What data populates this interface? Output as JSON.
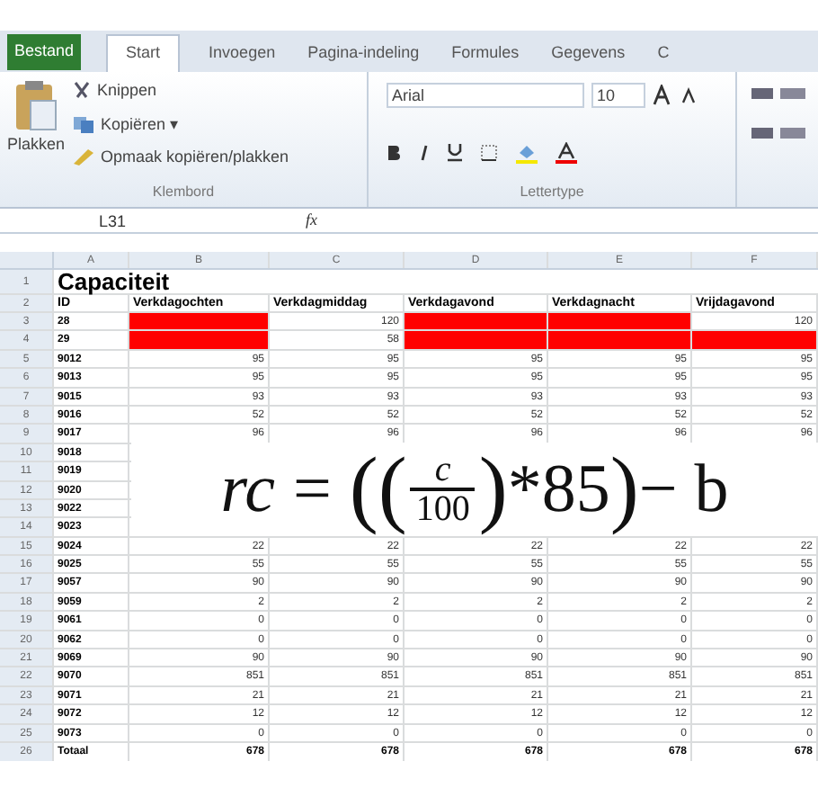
{
  "ribbon": {
    "file_tab": "Bestand",
    "tabs": [
      {
        "label": "Start",
        "selected": true
      },
      {
        "label": "Invoegen",
        "selected": false
      },
      {
        "label": "Pagina-indeling",
        "selected": false
      },
      {
        "label": "Formules",
        "selected": false
      },
      {
        "label": "Gegevens",
        "selected": false
      },
      {
        "label": "C",
        "selected": false
      }
    ],
    "clipboard": {
      "paste": "Plakken",
      "cut": "Knippen",
      "copy": "Kopiëren",
      "copy_caret": "▾",
      "format_painter": "Opmaak kopiëren/plakken",
      "group_label": "Klembord"
    },
    "font": {
      "family": "Arial",
      "size": "10",
      "group_label": "Lettertype"
    }
  },
  "formula_bar": {
    "name_box": "L31",
    "fx": "fx"
  },
  "columns": [
    "A",
    "B",
    "C",
    "D",
    "E",
    "F"
  ],
  "title_row": {
    "num": "1",
    "text": "Capaciteit"
  },
  "header_row": {
    "num": "2",
    "cells": [
      "ID",
      "Verkdagochten",
      "Verkdagmiddag",
      "Verkdagavond",
      "Verkdagnacht",
      "Vrijdagavond"
    ]
  },
  "rows": [
    {
      "num": "3",
      "id": "28",
      "cells": [
        {
          "red": true
        },
        {
          "value": "120",
          "red": false
        },
        {
          "red": true
        },
        {
          "red": true
        },
        {
          "value": "120",
          "red": false
        }
      ]
    },
    {
      "num": "4",
      "id": "29",
      "cells": [
        {
          "red": true
        },
        {
          "value": "58",
          "red": false
        },
        {
          "red": true
        },
        {
          "red": true
        },
        {
          "red": true
        }
      ]
    },
    {
      "num": "5",
      "id": "9012",
      "values": [
        "95",
        "95",
        "95",
        "95",
        "95"
      ]
    },
    {
      "num": "6",
      "id": "9013",
      "values": [
        "95",
        "95",
        "95",
        "95",
        "95"
      ]
    },
    {
      "num": "7",
      "id": "9015",
      "values": [
        "93",
        "93",
        "93",
        "93",
        "93"
      ]
    },
    {
      "num": "8",
      "id": "9016",
      "values": [
        "52",
        "52",
        "52",
        "52",
        "52"
      ]
    },
    {
      "num": "9",
      "id": "9017",
      "values": [
        "96",
        "96",
        "96",
        "96",
        "96"
      ]
    },
    {
      "num": "10",
      "id": "9018"
    },
    {
      "num": "11",
      "id": "9019"
    },
    {
      "num": "12",
      "id": "9020"
    },
    {
      "num": "13",
      "id": "9022"
    },
    {
      "num": "14",
      "id": "9023"
    },
    {
      "num": "15",
      "id": "9024",
      "values": [
        "22",
        "22",
        "22",
        "22",
        "22"
      ]
    },
    {
      "num": "16",
      "id": "9025",
      "values": [
        "55",
        "55",
        "55",
        "55",
        "55"
      ]
    },
    {
      "num": "17",
      "id": "9057",
      "values": [
        "90",
        "90",
        "90",
        "90",
        "90"
      ]
    },
    {
      "num": "18",
      "id": "9059",
      "values": [
        "2",
        "2",
        "2",
        "2",
        "2"
      ]
    },
    {
      "num": "19",
      "id": "9061",
      "values": [
        "0",
        "0",
        "0",
        "0",
        "0"
      ]
    },
    {
      "num": "20",
      "id": "9062",
      "values": [
        "0",
        "0",
        "0",
        "0",
        "0"
      ]
    },
    {
      "num": "21",
      "id": "9069",
      "values": [
        "90",
        "90",
        "90",
        "90",
        "90"
      ]
    },
    {
      "num": "22",
      "id": "9070",
      "values": [
        "851",
        "851",
        "851",
        "851",
        "851"
      ]
    },
    {
      "num": "23",
      "id": "9071",
      "values": [
        "21",
        "21",
        "21",
        "21",
        "21"
      ]
    },
    {
      "num": "24",
      "id": "9072",
      "values": [
        "12",
        "12",
        "12",
        "12",
        "12"
      ]
    },
    {
      "num": "25",
      "id": "9073",
      "values": [
        "0",
        "0",
        "0",
        "0",
        "0"
      ]
    }
  ],
  "total_row": {
    "num": "26",
    "label": "Totaal",
    "values": [
      "678",
      "678",
      "678",
      "678",
      "678"
    ]
  },
  "formula": {
    "lhs": "rc",
    "equals": "=",
    "open": "((",
    "numerator": "c",
    "denominator": "100",
    "close_inner": ")",
    "times": "*85",
    "close_outer": ")",
    "minus": "− b"
  }
}
